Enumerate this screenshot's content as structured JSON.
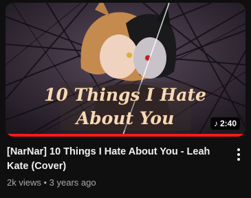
{
  "video": {
    "thumbnail_text_line1": "10 Things I Hate",
    "thumbnail_text_line2": "About You",
    "duration": "2:40",
    "duration_icon": "music-note-icon",
    "watch_progress": 1.0,
    "title": "[NarNar] 10 Things I Hate About You - Leah Kate (Cover)",
    "views": "2k views",
    "separator": "•",
    "age": "3 years ago",
    "menu_icon": "more-vertical-icon"
  },
  "colors": {
    "background": "#0f0f0f",
    "title": "#f1f1f1",
    "meta": "#aaaaaa",
    "progress": "#ff1a1a"
  }
}
